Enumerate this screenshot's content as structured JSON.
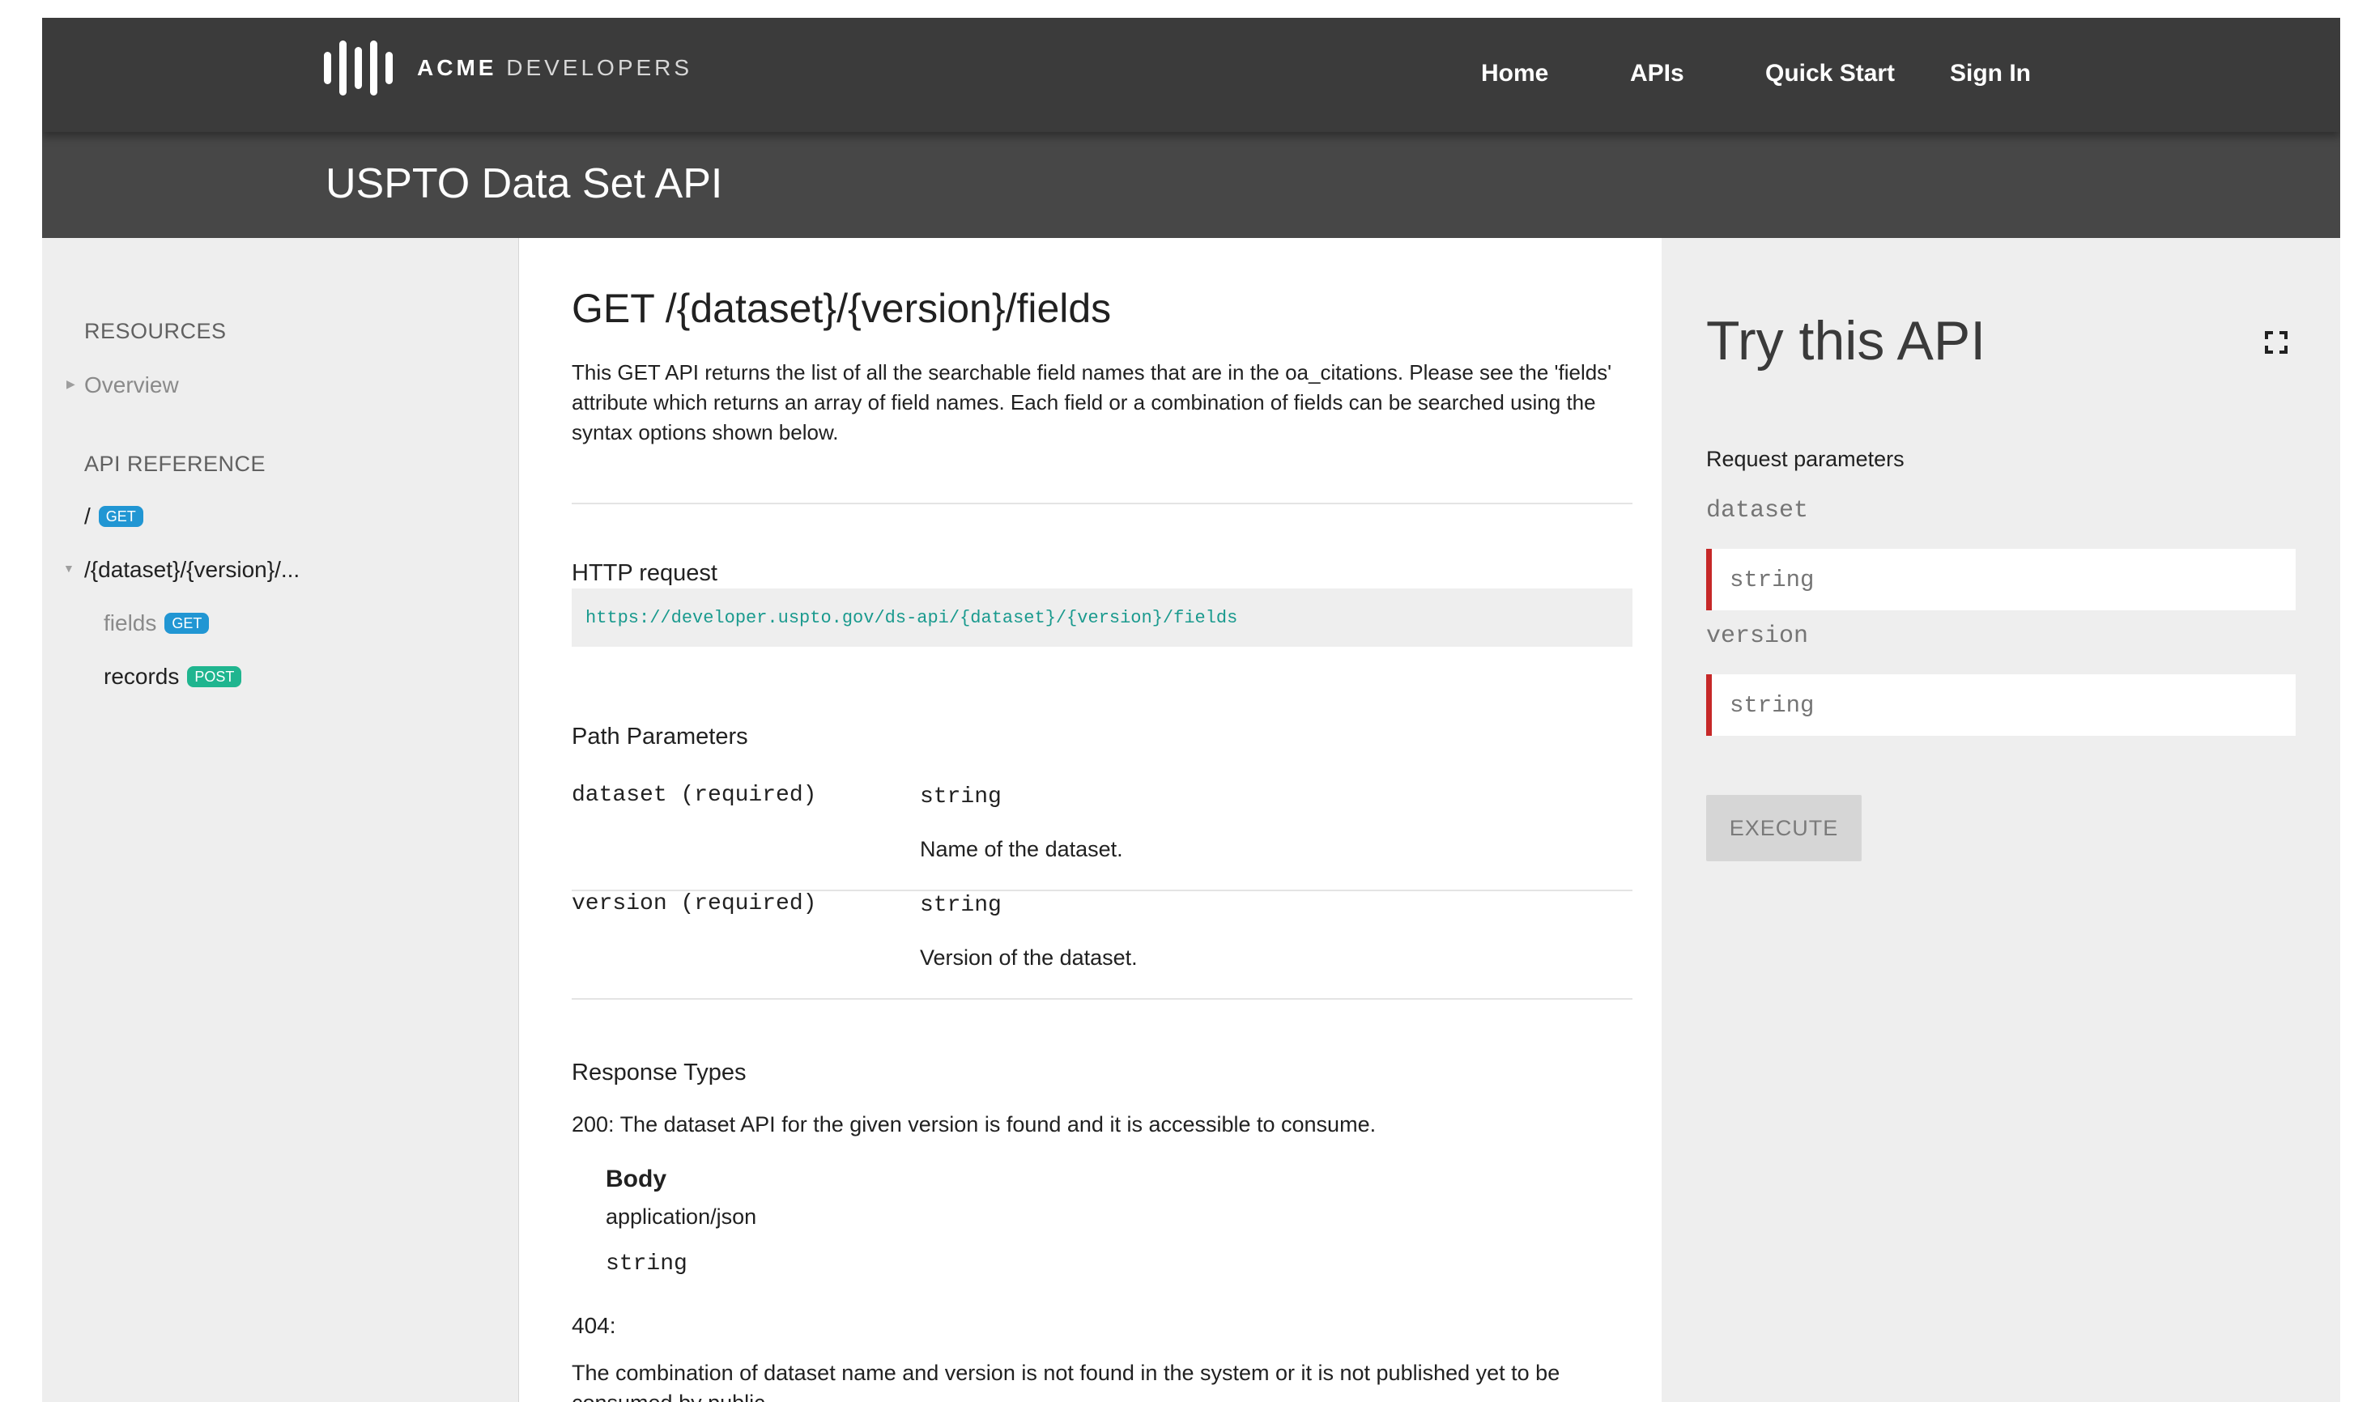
{
  "brand": {
    "logo_bold": "ACME",
    "logo_light": "DEVELOPERS"
  },
  "nav": {
    "home": "Home",
    "apis": "APIs",
    "quick_start": "Quick Start",
    "sign_in": "Sign In"
  },
  "page_title": "USPTO Data Set API",
  "sidebar": {
    "resources_heading": "RESOURCES",
    "overview": "Overview",
    "api_reference_heading": "API REFERENCE",
    "root_path": "/",
    "root_badge": "GET",
    "dataset_path": "/{dataset}/{version}/...",
    "fields_label": "fields",
    "fields_badge": "GET",
    "records_label": "records",
    "records_badge": "POST"
  },
  "main": {
    "title": "GET /{dataset}/{version}/fields",
    "description": "This GET API returns the list of all the searchable field names that are in the oa_citations. Please see the 'fields' attribute which returns an array of field names. Each field or a combination of fields can be searched using the syntax options shown below.",
    "http_request_heading": "HTTP request",
    "http_request_url": "https://developer.uspto.gov/ds-api/{dataset}/{version}/fields",
    "path_params_heading": "Path Parameters",
    "params": [
      {
        "name": "dataset (required)",
        "type": "string",
        "description": "Name of the dataset."
      },
      {
        "name": "version (required)",
        "type": "string",
        "description": "Version of the dataset."
      }
    ],
    "response_types_heading": "Response Types",
    "response_200": "200: The dataset API for the given version is found and it is accessible to consume.",
    "body_label": "Body",
    "body_content_type": "application/json",
    "body_type": "string",
    "response_404_code": "404:",
    "response_404_text": "The combination of dataset name and version is not found in the system or it is not published yet to be consumed by public."
  },
  "try_panel": {
    "title": "Try this API",
    "request_params_label": "Request parameters",
    "dataset_label": "dataset",
    "dataset_placeholder": "string",
    "version_label": "version",
    "version_placeholder": "string",
    "execute_label": "EXECUTE"
  }
}
